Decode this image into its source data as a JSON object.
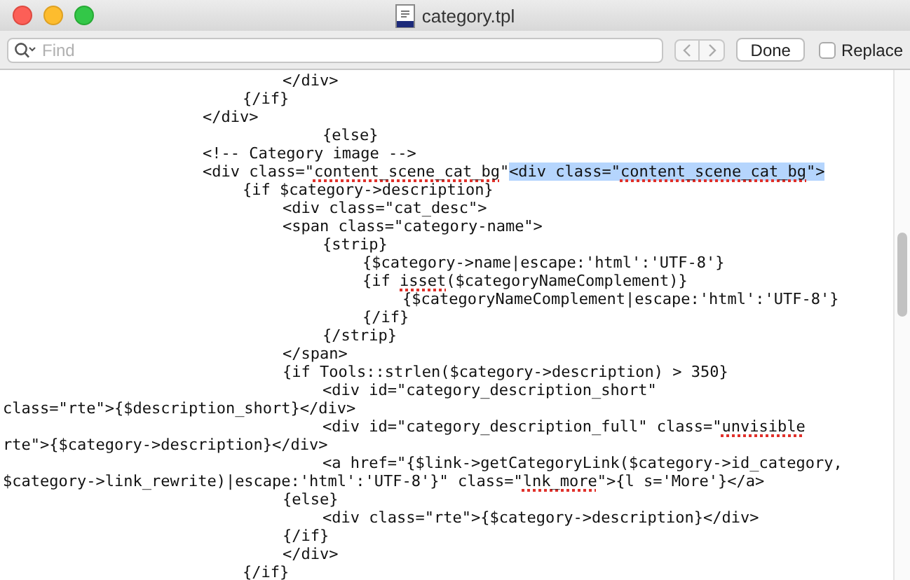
{
  "window": {
    "title": "category.tpl"
  },
  "find_bar": {
    "placeholder": "Find",
    "done": "Done",
    "replace": {
      "label": "Replace",
      "checked": false
    }
  },
  "editor": {
    "lines": [
      [
        {
          "kind": "plain",
          "text": "\t\t\t\t\t\t\t</div>"
        }
      ],
      [
        {
          "kind": "plain",
          "text": "\t\t\t\t\t\t{/if}"
        }
      ],
      [
        {
          "kind": "plain",
          "text": "\t\t\t\t\t</div>"
        }
      ],
      [
        {
          "kind": "plain",
          "text": "\t\t\t\t\t\t\t\t{else}"
        }
      ],
      [
        {
          "kind": "plain",
          "text": "\t\t\t\t\t<!-- Category image -->"
        }
      ],
      [
        {
          "kind": "plain",
          "text": "\t\t\t\t\t<div class=\""
        },
        {
          "kind": "misspelled",
          "text": "content_scene_cat_bg"
        },
        {
          "kind": "plain",
          "text": "\""
        },
        {
          "kind": "selected",
          "text": "<div class=\""
        },
        {
          "kind": "selected-misspelled",
          "text": "content_scene_cat_bg"
        },
        {
          "kind": "selected",
          "text": "\">"
        }
      ],
      [
        {
          "kind": "plain",
          "text": "\t\t\t\t\t\t{if $category->description}"
        }
      ],
      [
        {
          "kind": "plain",
          "text": "\t\t\t\t\t\t\t<div class=\"cat_desc\">"
        }
      ],
      [
        {
          "kind": "plain",
          "text": "\t\t\t\t\t\t\t<span class=\"category-name\">"
        }
      ],
      [
        {
          "kind": "plain",
          "text": "\t\t\t\t\t\t\t\t{strip}"
        }
      ],
      [
        {
          "kind": "plain",
          "text": "\t\t\t\t\t\t\t\t\t{$category->name|escape:'html':'UTF-8'}"
        }
      ],
      [
        {
          "kind": "plain",
          "text": "\t\t\t\t\t\t\t\t\t{if "
        },
        {
          "kind": "misspelled",
          "text": "isset"
        },
        {
          "kind": "plain",
          "text": "($categoryNameComplement)}"
        }
      ],
      [
        {
          "kind": "plain",
          "text": "\t\t\t\t\t\t\t\t\t\t{$categoryNameComplement|escape:'html':'UTF-8'}"
        }
      ],
      [
        {
          "kind": "plain",
          "text": "\t\t\t\t\t\t\t\t\t{/if}"
        }
      ],
      [
        {
          "kind": "plain",
          "text": "\t\t\t\t\t\t\t\t{/strip}"
        }
      ],
      [
        {
          "kind": "plain",
          "text": "\t\t\t\t\t\t\t</span>"
        }
      ],
      [
        {
          "kind": "plain",
          "text": "\t\t\t\t\t\t\t{if Tools::strlen($category->description) > 350}"
        }
      ],
      [
        {
          "kind": "plain",
          "text": "\t\t\t\t\t\t\t\t<div id=\"category_description_short\""
        }
      ],
      [
        {
          "kind": "plain",
          "text": "class=\"rte\">{$description_short}</div>"
        }
      ],
      [
        {
          "kind": "plain",
          "text": "\t\t\t\t\t\t\t\t<div id=\"category_description_full\" class=\""
        },
        {
          "kind": "misspelled",
          "text": "unvisible"
        }
      ],
      [
        {
          "kind": "plain",
          "text": "rte\">{$category->description}</div>"
        }
      ],
      [
        {
          "kind": "plain",
          "text": "\t\t\t\t\t\t\t\t<a href=\"{$link->getCategoryLink($category->id_category,"
        }
      ],
      [
        {
          "kind": "plain",
          "text": "$category->link_rewrite)|escape:'html':'UTF-8'}\" class=\""
        },
        {
          "kind": "misspelled",
          "text": "lnk_more"
        },
        {
          "kind": "plain",
          "text": "\">{l s='More'}</a>"
        }
      ],
      [
        {
          "kind": "plain",
          "text": "\t\t\t\t\t\t\t{else}"
        }
      ],
      [
        {
          "kind": "plain",
          "text": "\t\t\t\t\t\t\t\t<div class=\"rte\">{$category->description}</div>"
        }
      ],
      [
        {
          "kind": "plain",
          "text": "\t\t\t\t\t\t\t{/if}"
        }
      ],
      [
        {
          "kind": "plain",
          "text": "\t\t\t\t\t\t\t</div>"
        }
      ],
      [
        {
          "kind": "plain",
          "text": "\t\t\t\t\t\t{/if}"
        }
      ]
    ]
  }
}
